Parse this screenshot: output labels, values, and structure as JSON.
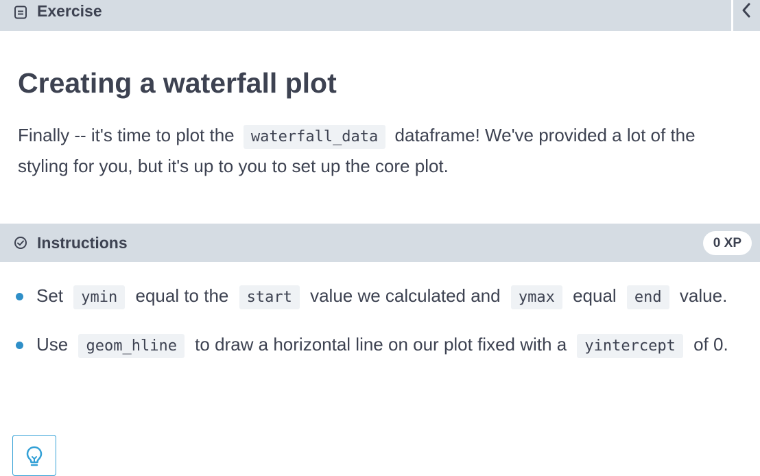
{
  "header": {
    "tab_icon": "notepad-icon",
    "tab_title": "Exercise",
    "collapse_icon": "chevron-left-icon"
  },
  "exercise": {
    "title": "Creating a waterfall plot",
    "description": {
      "part1": "Finally -- it's time to plot the",
      "code1": "waterfall_data",
      "part2": "dataframe! We've provided a lot of the styling for you, but it's up to you to set up the core plot."
    }
  },
  "instructions": {
    "icon": "check-circle-icon",
    "title": "Instructions",
    "xp": "0 XP",
    "items": [
      {
        "t1": "Set",
        "c1": "ymin",
        "t2": "equal to the",
        "c2": "start",
        "t3": "value we calculated and",
        "c3": "ymax",
        "t4": "equal",
        "c4": "end",
        "t5": "value."
      },
      {
        "t1": "Use",
        "c1": "geom_hline",
        "t2": "to draw a horizontal line on our plot fixed with a",
        "c2": "yintercept",
        "t3": "of 0."
      }
    ]
  },
  "hint": {
    "icon": "lightbulb-icon"
  },
  "colors": {
    "bar_background": "#d5dce3",
    "text": "#3d4251",
    "code_background": "#eff2f5",
    "bullet": "#2f8fc8",
    "hint_accent": "#33a0d6"
  }
}
